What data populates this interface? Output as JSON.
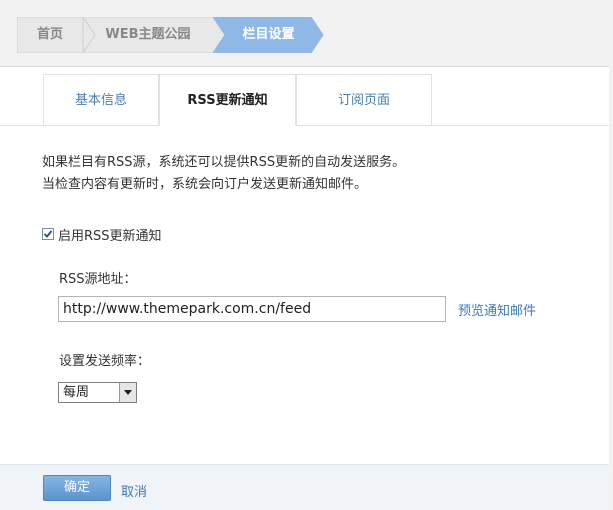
{
  "breadcrumb": {
    "home": "首页",
    "site": "WEB主题公园",
    "current": "栏目设置"
  },
  "tabs": {
    "basic": "基本信息",
    "rss": "RSS更新通知",
    "subscribe": "订阅页面"
  },
  "description": {
    "line1": "如果栏目有RSS源，系统还可以提供RSS更新的自动发送服务。",
    "line2": "当检查内容有更新时，系统会向订户发送更新通知邮件。"
  },
  "enable": {
    "label": "启用RSS更新通知",
    "checked": true
  },
  "rss_source": {
    "label": "RSS源地址：",
    "value": "http://www.themepark.com.cn/feed",
    "preview_link": "预览通知邮件"
  },
  "frequency": {
    "label": "设置发送频率：",
    "selected": "每周"
  },
  "actions": {
    "ok": "确定",
    "cancel": "取消"
  },
  "colors": {
    "crumb_active": "#8fb8e6",
    "link": "#3d7ab8",
    "ok_button": "#6fa3d8"
  }
}
